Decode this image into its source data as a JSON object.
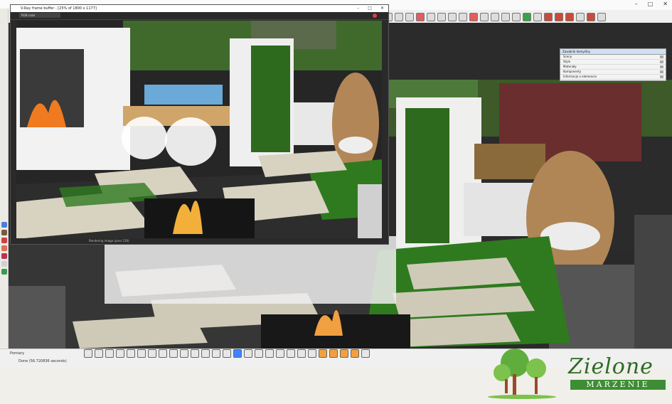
{
  "render_window": {
    "title": "V-Ray frame buffer - [25% of 1800 x 1177]",
    "channel_select": "RGB color",
    "footer": "Rendering image (pass 126)",
    "win_min": "–",
    "win_max": "□",
    "win_close": "✕"
  },
  "main_window": {
    "win_min": "–",
    "win_max": "□",
    "win_close": "✕"
  },
  "default_tray": {
    "header": "Zasobnik domyślny",
    "items": [
      "Sceny",
      "Style",
      "Materiały",
      "Komponenty",
      "Informacje o elemencie"
    ]
  },
  "status": {
    "scene_tab": "Pomiary",
    "done": "Done (56.720836 seconds)"
  },
  "logo": {
    "word": "Zielone",
    "band": "MARZENIE"
  },
  "colors": {
    "grass": "#2f7a1f",
    "slab": "#cfcab8",
    "wall": "#efefee",
    "logo_green": "#3e8d35"
  }
}
